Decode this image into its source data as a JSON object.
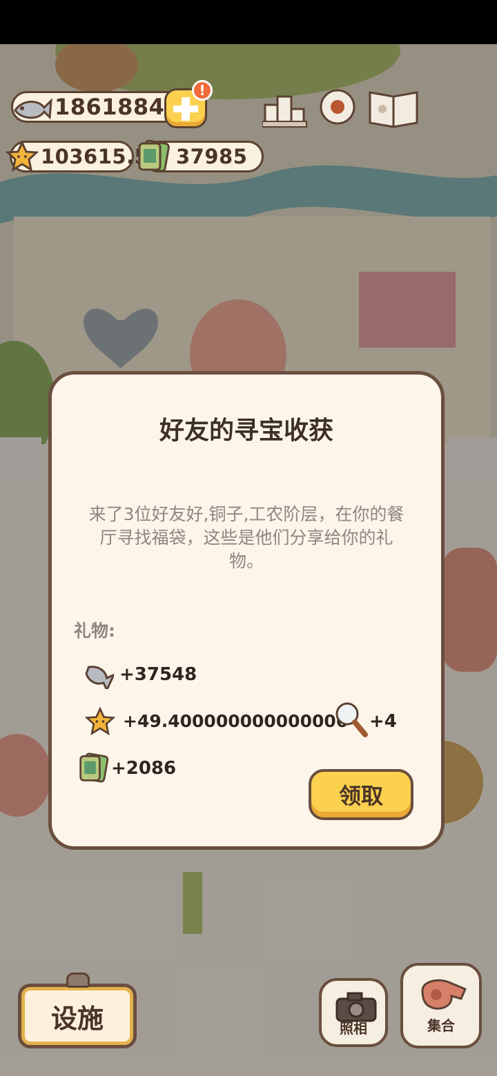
{
  "hud": {
    "fish_count": "18618849",
    "star_count": "103615.5",
    "ticket_count": "37985"
  },
  "dialog": {
    "title": "好友的寻宝收获",
    "message": "来了3位好友好,铜子,工农阶层，在你的餐厅寻找福袋，这些是他们分享给你的礼物。",
    "gift_label": "礼物:",
    "rewards": {
      "fish": "+37548",
      "star": "+49.400000000000006",
      "magnifier": "+4",
      "ticket": "+2086"
    },
    "claim_label": "领取"
  },
  "bottom": {
    "facility_label": "设施",
    "photo_label": "照相",
    "gather_label": "集合"
  },
  "colors": {
    "accent_yellow": "#fcd14f",
    "border_brown": "#6a4e3e",
    "panel_cream": "#fdf5ea",
    "text_dark": "#3d2e26",
    "text_gray": "#8e8680"
  }
}
